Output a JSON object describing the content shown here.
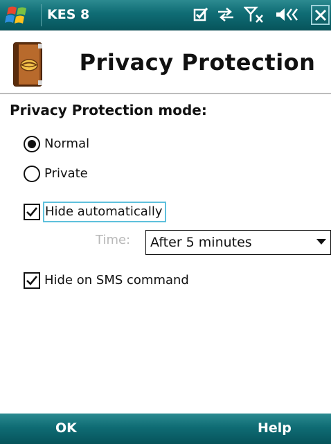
{
  "titlebar": {
    "app_name": "KES 8",
    "icons": [
      "windows-start-icon",
      "tasks-check-icon",
      "sync-arrows-icon",
      "no-signal-icon",
      "volume-icon",
      "close-icon"
    ]
  },
  "header": {
    "title": "Privacy Protection",
    "icon": "privacy-book-icon"
  },
  "content": {
    "mode_label": "Privacy Protection mode:",
    "mode_options": [
      {
        "label": "Normal",
        "selected": true
      },
      {
        "label": "Private",
        "selected": false
      }
    ],
    "hide_automatically": {
      "label": "Hide automatically",
      "checked": true
    },
    "time": {
      "label": "Time:",
      "value": "After 5 minutes"
    },
    "hide_on_sms": {
      "label": "Hide on SMS command",
      "checked": true
    }
  },
  "softkeys": {
    "left": "OK",
    "right": "Help"
  },
  "colors": {
    "bar": "#0f6c74",
    "focus": "#5ec0dc",
    "disabled_text": "#b8b8b8"
  }
}
